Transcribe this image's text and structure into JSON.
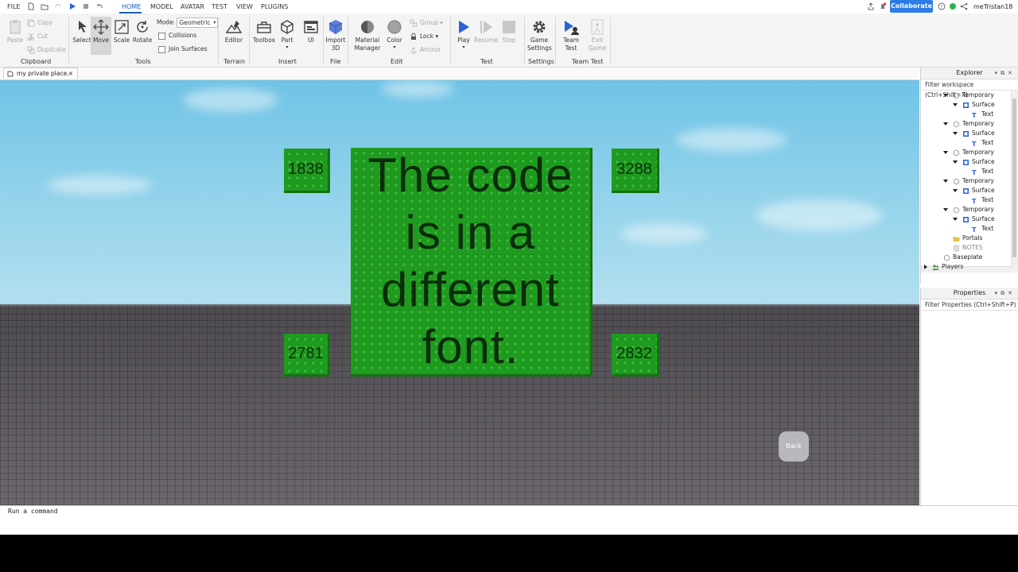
{
  "menu": {
    "items": [
      "FILE",
      "HOME",
      "MODEL",
      "AVATAR",
      "TEST",
      "VIEW",
      "PLUGINS"
    ],
    "active": "HOME",
    "collaborate_label": "Collaborate",
    "username": "meTristan18"
  },
  "ribbon": {
    "clipboard": {
      "paste": "Paste",
      "copy": "Copy",
      "cut": "Cut",
      "duplicate": "Duplicate",
      "group_label": "Clipboard"
    },
    "tools": {
      "select": "Select",
      "move": "Move",
      "scale": "Scale",
      "rotate": "Rotate",
      "mode_label": "Mode:",
      "mode_value": "Geometric",
      "collisions": "Collisions",
      "join_surfaces": "Join Surfaces",
      "group_label": "Tools"
    },
    "terrain": {
      "editor": "Editor",
      "group_label": "Terrain"
    },
    "insert": {
      "toolbox": "Toolbox",
      "part": "Part",
      "ui": "UI",
      "group_label": "Insert"
    },
    "file": {
      "import_line1": "Import",
      "import_line2": "3D",
      "group_label": "File"
    },
    "edit": {
      "material_line1": "Material",
      "material_line2": "Manager",
      "color": "Color",
      "group": "Group",
      "lock": "Lock",
      "anchor": "Anchor",
      "group_label": "Edit"
    },
    "test": {
      "play": "Play",
      "resume": "Resume",
      "stop": "Stop",
      "group_label": "Test"
    },
    "settings": {
      "game_line1": "Game",
      "game_line2": "Settings",
      "group_label": "Settings"
    },
    "team_test": {
      "team_line1": "Team",
      "team_line2": "Test",
      "exit_line1": "Exit",
      "exit_line2": "Game",
      "group_label": "Team Test"
    }
  },
  "document_tab": {
    "label": "my private place.",
    "close": "×"
  },
  "viewport": {
    "big_sign": [
      "The code",
      "is in a",
      "different",
      "font."
    ],
    "corner_codes": {
      "top_left": "1838",
      "top_right": "3288",
      "bottom_left": "2781",
      "bottom_right": "2832"
    },
    "back_label": "Back"
  },
  "command_bar": {
    "placeholder": "Run a command"
  },
  "explorer": {
    "title": "Explorer",
    "filter_placeholder": "Filter workspace (Ctrl+Shift+X)",
    "rows": [
      {
        "label": "Temporary",
        "kind": "model",
        "depth": 3,
        "expanded": true
      },
      {
        "label": "Surface",
        "kind": "gui",
        "depth": 4,
        "expanded": true
      },
      {
        "label": "Text",
        "kind": "text",
        "depth": 5
      },
      {
        "label": "Temporary",
        "kind": "model",
        "depth": 3,
        "expanded": true
      },
      {
        "label": "Surface",
        "kind": "gui",
        "depth": 4,
        "expanded": true
      },
      {
        "label": "Text",
        "kind": "text",
        "depth": 5
      },
      {
        "label": "Temporary",
        "kind": "model",
        "depth": 3,
        "expanded": true
      },
      {
        "label": "Surface",
        "kind": "gui",
        "depth": 4,
        "expanded": true
      },
      {
        "label": "Text",
        "kind": "text",
        "depth": 5
      },
      {
        "label": "Temporary",
        "kind": "model",
        "depth": 3,
        "expanded": true
      },
      {
        "label": "Surface",
        "kind": "gui",
        "depth": 4,
        "expanded": true
      },
      {
        "label": "Text",
        "kind": "text",
        "depth": 5
      },
      {
        "label": "Temporary",
        "kind": "model",
        "depth": 3,
        "expanded": true
      },
      {
        "label": "Surface",
        "kind": "gui",
        "depth": 4,
        "expanded": true
      },
      {
        "label": "Text",
        "kind": "text",
        "depth": 5
      },
      {
        "label": "Portals",
        "kind": "folder",
        "depth": 3
      },
      {
        "label": "NOTES",
        "kind": "notes",
        "depth": 3
      },
      {
        "label": "Baseplate",
        "kind": "model",
        "depth": 2
      },
      {
        "label": "Players",
        "kind": "players",
        "depth": 1,
        "collapsed": true
      }
    ]
  },
  "properties": {
    "title": "Properties",
    "filter_placeholder": "Filter Properties (Ctrl+Shift+P)"
  },
  "colors": {
    "accent": "#2d7ce6",
    "block_green": "#1f9c1f",
    "sky": "#8fd1ea",
    "baseplate": "#5d5a5e"
  }
}
